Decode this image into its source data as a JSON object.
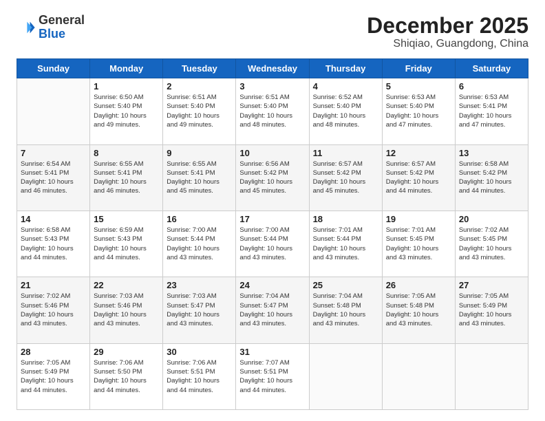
{
  "header": {
    "logo_general": "General",
    "logo_blue": "Blue",
    "month_title": "December 2025",
    "location": "Shiqiao, Guangdong, China"
  },
  "days_of_week": [
    "Sunday",
    "Monday",
    "Tuesday",
    "Wednesday",
    "Thursday",
    "Friday",
    "Saturday"
  ],
  "weeks": [
    [
      {
        "day": "",
        "info": ""
      },
      {
        "day": "1",
        "info": "Sunrise: 6:50 AM\nSunset: 5:40 PM\nDaylight: 10 hours\nand 49 minutes."
      },
      {
        "day": "2",
        "info": "Sunrise: 6:51 AM\nSunset: 5:40 PM\nDaylight: 10 hours\nand 49 minutes."
      },
      {
        "day": "3",
        "info": "Sunrise: 6:51 AM\nSunset: 5:40 PM\nDaylight: 10 hours\nand 48 minutes."
      },
      {
        "day": "4",
        "info": "Sunrise: 6:52 AM\nSunset: 5:40 PM\nDaylight: 10 hours\nand 48 minutes."
      },
      {
        "day": "5",
        "info": "Sunrise: 6:53 AM\nSunset: 5:40 PM\nDaylight: 10 hours\nand 47 minutes."
      },
      {
        "day": "6",
        "info": "Sunrise: 6:53 AM\nSunset: 5:41 PM\nDaylight: 10 hours\nand 47 minutes."
      }
    ],
    [
      {
        "day": "7",
        "info": "Sunrise: 6:54 AM\nSunset: 5:41 PM\nDaylight: 10 hours\nand 46 minutes."
      },
      {
        "day": "8",
        "info": "Sunrise: 6:55 AM\nSunset: 5:41 PM\nDaylight: 10 hours\nand 46 minutes."
      },
      {
        "day": "9",
        "info": "Sunrise: 6:55 AM\nSunset: 5:41 PM\nDaylight: 10 hours\nand 45 minutes."
      },
      {
        "day": "10",
        "info": "Sunrise: 6:56 AM\nSunset: 5:42 PM\nDaylight: 10 hours\nand 45 minutes."
      },
      {
        "day": "11",
        "info": "Sunrise: 6:57 AM\nSunset: 5:42 PM\nDaylight: 10 hours\nand 45 minutes."
      },
      {
        "day": "12",
        "info": "Sunrise: 6:57 AM\nSunset: 5:42 PM\nDaylight: 10 hours\nand 44 minutes."
      },
      {
        "day": "13",
        "info": "Sunrise: 6:58 AM\nSunset: 5:42 PM\nDaylight: 10 hours\nand 44 minutes."
      }
    ],
    [
      {
        "day": "14",
        "info": "Sunrise: 6:58 AM\nSunset: 5:43 PM\nDaylight: 10 hours\nand 44 minutes."
      },
      {
        "day": "15",
        "info": "Sunrise: 6:59 AM\nSunset: 5:43 PM\nDaylight: 10 hours\nand 44 minutes."
      },
      {
        "day": "16",
        "info": "Sunrise: 7:00 AM\nSunset: 5:44 PM\nDaylight: 10 hours\nand 43 minutes."
      },
      {
        "day": "17",
        "info": "Sunrise: 7:00 AM\nSunset: 5:44 PM\nDaylight: 10 hours\nand 43 minutes."
      },
      {
        "day": "18",
        "info": "Sunrise: 7:01 AM\nSunset: 5:44 PM\nDaylight: 10 hours\nand 43 minutes."
      },
      {
        "day": "19",
        "info": "Sunrise: 7:01 AM\nSunset: 5:45 PM\nDaylight: 10 hours\nand 43 minutes."
      },
      {
        "day": "20",
        "info": "Sunrise: 7:02 AM\nSunset: 5:45 PM\nDaylight: 10 hours\nand 43 minutes."
      }
    ],
    [
      {
        "day": "21",
        "info": "Sunrise: 7:02 AM\nSunset: 5:46 PM\nDaylight: 10 hours\nand 43 minutes."
      },
      {
        "day": "22",
        "info": "Sunrise: 7:03 AM\nSunset: 5:46 PM\nDaylight: 10 hours\nand 43 minutes."
      },
      {
        "day": "23",
        "info": "Sunrise: 7:03 AM\nSunset: 5:47 PM\nDaylight: 10 hours\nand 43 minutes."
      },
      {
        "day": "24",
        "info": "Sunrise: 7:04 AM\nSunset: 5:47 PM\nDaylight: 10 hours\nand 43 minutes."
      },
      {
        "day": "25",
        "info": "Sunrise: 7:04 AM\nSunset: 5:48 PM\nDaylight: 10 hours\nand 43 minutes."
      },
      {
        "day": "26",
        "info": "Sunrise: 7:05 AM\nSunset: 5:48 PM\nDaylight: 10 hours\nand 43 minutes."
      },
      {
        "day": "27",
        "info": "Sunrise: 7:05 AM\nSunset: 5:49 PM\nDaylight: 10 hours\nand 43 minutes."
      }
    ],
    [
      {
        "day": "28",
        "info": "Sunrise: 7:05 AM\nSunset: 5:49 PM\nDaylight: 10 hours\nand 44 minutes."
      },
      {
        "day": "29",
        "info": "Sunrise: 7:06 AM\nSunset: 5:50 PM\nDaylight: 10 hours\nand 44 minutes."
      },
      {
        "day": "30",
        "info": "Sunrise: 7:06 AM\nSunset: 5:51 PM\nDaylight: 10 hours\nand 44 minutes."
      },
      {
        "day": "31",
        "info": "Sunrise: 7:07 AM\nSunset: 5:51 PM\nDaylight: 10 hours\nand 44 minutes."
      },
      {
        "day": "",
        "info": ""
      },
      {
        "day": "",
        "info": ""
      },
      {
        "day": "",
        "info": ""
      }
    ]
  ]
}
